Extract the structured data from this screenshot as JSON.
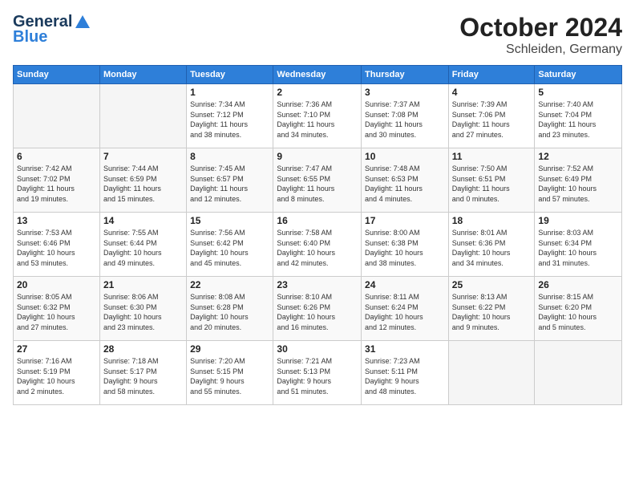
{
  "header": {
    "logo_general": "General",
    "logo_blue": "Blue",
    "month": "October 2024",
    "location": "Schleiden, Germany"
  },
  "days_of_week": [
    "Sunday",
    "Monday",
    "Tuesday",
    "Wednesday",
    "Thursday",
    "Friday",
    "Saturday"
  ],
  "weeks": [
    [
      {
        "day": "",
        "info": ""
      },
      {
        "day": "",
        "info": ""
      },
      {
        "day": "1",
        "info": "Sunrise: 7:34 AM\nSunset: 7:12 PM\nDaylight: 11 hours\nand 38 minutes."
      },
      {
        "day": "2",
        "info": "Sunrise: 7:36 AM\nSunset: 7:10 PM\nDaylight: 11 hours\nand 34 minutes."
      },
      {
        "day": "3",
        "info": "Sunrise: 7:37 AM\nSunset: 7:08 PM\nDaylight: 11 hours\nand 30 minutes."
      },
      {
        "day": "4",
        "info": "Sunrise: 7:39 AM\nSunset: 7:06 PM\nDaylight: 11 hours\nand 27 minutes."
      },
      {
        "day": "5",
        "info": "Sunrise: 7:40 AM\nSunset: 7:04 PM\nDaylight: 11 hours\nand 23 minutes."
      }
    ],
    [
      {
        "day": "6",
        "info": "Sunrise: 7:42 AM\nSunset: 7:02 PM\nDaylight: 11 hours\nand 19 minutes."
      },
      {
        "day": "7",
        "info": "Sunrise: 7:44 AM\nSunset: 6:59 PM\nDaylight: 11 hours\nand 15 minutes."
      },
      {
        "day": "8",
        "info": "Sunrise: 7:45 AM\nSunset: 6:57 PM\nDaylight: 11 hours\nand 12 minutes."
      },
      {
        "day": "9",
        "info": "Sunrise: 7:47 AM\nSunset: 6:55 PM\nDaylight: 11 hours\nand 8 minutes."
      },
      {
        "day": "10",
        "info": "Sunrise: 7:48 AM\nSunset: 6:53 PM\nDaylight: 11 hours\nand 4 minutes."
      },
      {
        "day": "11",
        "info": "Sunrise: 7:50 AM\nSunset: 6:51 PM\nDaylight: 11 hours\nand 0 minutes."
      },
      {
        "day": "12",
        "info": "Sunrise: 7:52 AM\nSunset: 6:49 PM\nDaylight: 10 hours\nand 57 minutes."
      }
    ],
    [
      {
        "day": "13",
        "info": "Sunrise: 7:53 AM\nSunset: 6:46 PM\nDaylight: 10 hours\nand 53 minutes."
      },
      {
        "day": "14",
        "info": "Sunrise: 7:55 AM\nSunset: 6:44 PM\nDaylight: 10 hours\nand 49 minutes."
      },
      {
        "day": "15",
        "info": "Sunrise: 7:56 AM\nSunset: 6:42 PM\nDaylight: 10 hours\nand 45 minutes."
      },
      {
        "day": "16",
        "info": "Sunrise: 7:58 AM\nSunset: 6:40 PM\nDaylight: 10 hours\nand 42 minutes."
      },
      {
        "day": "17",
        "info": "Sunrise: 8:00 AM\nSunset: 6:38 PM\nDaylight: 10 hours\nand 38 minutes."
      },
      {
        "day": "18",
        "info": "Sunrise: 8:01 AM\nSunset: 6:36 PM\nDaylight: 10 hours\nand 34 minutes."
      },
      {
        "day": "19",
        "info": "Sunrise: 8:03 AM\nSunset: 6:34 PM\nDaylight: 10 hours\nand 31 minutes."
      }
    ],
    [
      {
        "day": "20",
        "info": "Sunrise: 8:05 AM\nSunset: 6:32 PM\nDaylight: 10 hours\nand 27 minutes."
      },
      {
        "day": "21",
        "info": "Sunrise: 8:06 AM\nSunset: 6:30 PM\nDaylight: 10 hours\nand 23 minutes."
      },
      {
        "day": "22",
        "info": "Sunrise: 8:08 AM\nSunset: 6:28 PM\nDaylight: 10 hours\nand 20 minutes."
      },
      {
        "day": "23",
        "info": "Sunrise: 8:10 AM\nSunset: 6:26 PM\nDaylight: 10 hours\nand 16 minutes."
      },
      {
        "day": "24",
        "info": "Sunrise: 8:11 AM\nSunset: 6:24 PM\nDaylight: 10 hours\nand 12 minutes."
      },
      {
        "day": "25",
        "info": "Sunrise: 8:13 AM\nSunset: 6:22 PM\nDaylight: 10 hours\nand 9 minutes."
      },
      {
        "day": "26",
        "info": "Sunrise: 8:15 AM\nSunset: 6:20 PM\nDaylight: 10 hours\nand 5 minutes."
      }
    ],
    [
      {
        "day": "27",
        "info": "Sunrise: 7:16 AM\nSunset: 5:19 PM\nDaylight: 10 hours\nand 2 minutes."
      },
      {
        "day": "28",
        "info": "Sunrise: 7:18 AM\nSunset: 5:17 PM\nDaylight: 9 hours\nand 58 minutes."
      },
      {
        "day": "29",
        "info": "Sunrise: 7:20 AM\nSunset: 5:15 PM\nDaylight: 9 hours\nand 55 minutes."
      },
      {
        "day": "30",
        "info": "Sunrise: 7:21 AM\nSunset: 5:13 PM\nDaylight: 9 hours\nand 51 minutes."
      },
      {
        "day": "31",
        "info": "Sunrise: 7:23 AM\nSunset: 5:11 PM\nDaylight: 9 hours\nand 48 minutes."
      },
      {
        "day": "",
        "info": ""
      },
      {
        "day": "",
        "info": ""
      }
    ]
  ]
}
